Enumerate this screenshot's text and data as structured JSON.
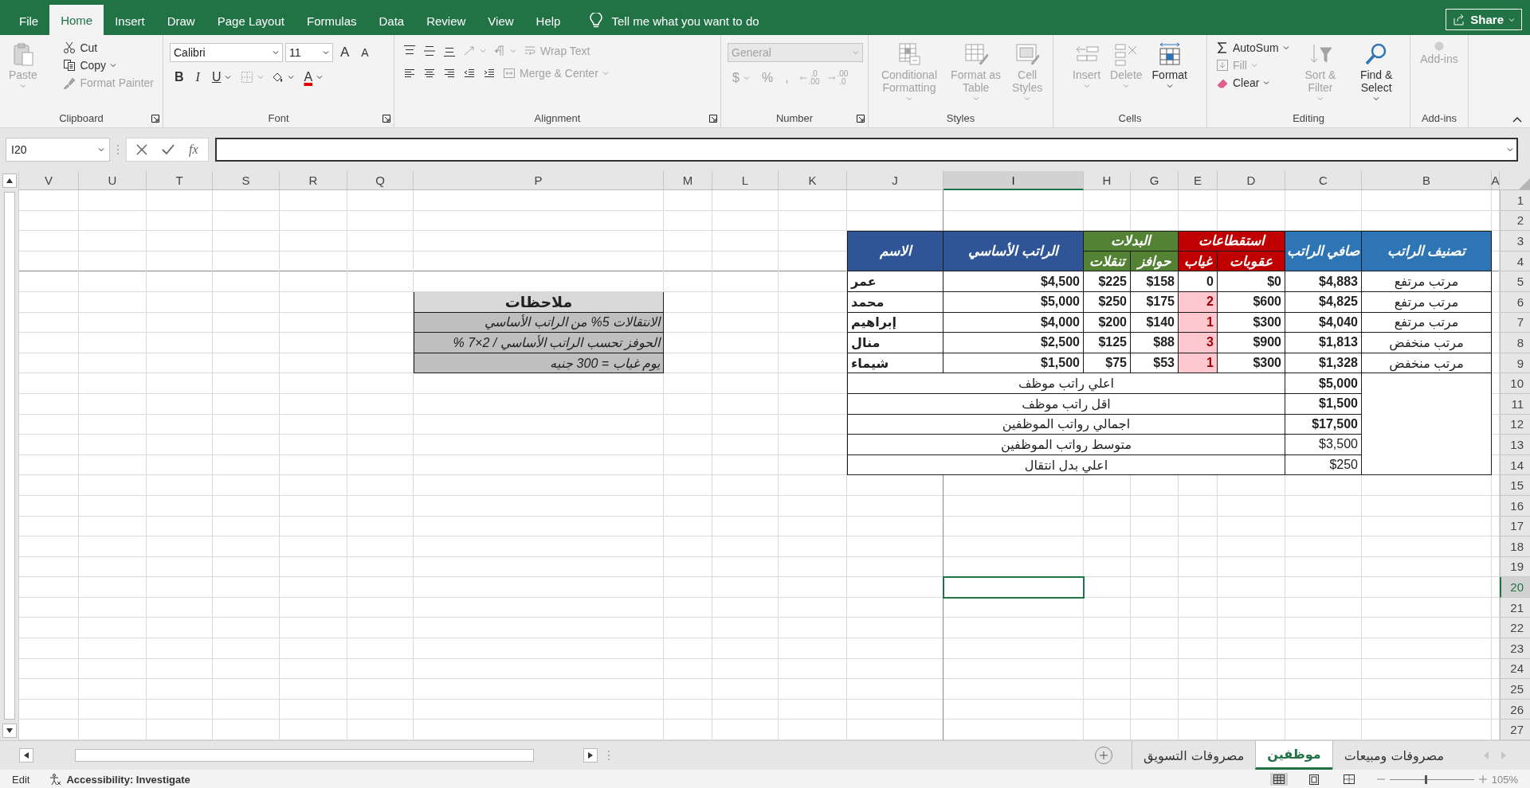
{
  "app_tabs": [
    {
      "label": "File",
      "selected": false
    },
    {
      "label": "Home",
      "selected": true
    },
    {
      "label": "Insert",
      "selected": false
    },
    {
      "label": "Draw",
      "selected": false
    },
    {
      "label": "Page Layout",
      "selected": false
    },
    {
      "label": "Formulas",
      "selected": false
    },
    {
      "label": "Data",
      "selected": false
    },
    {
      "label": "Review",
      "selected": false
    },
    {
      "label": "View",
      "selected": false
    },
    {
      "label": "Help",
      "selected": false
    }
  ],
  "tell_me": "Tell me what you want to do",
  "share": "Share",
  "ribbon": [
    {
      "label": "Clipboard",
      "launcher": true,
      "sections": [
        {
          "kind": "large",
          "items": [
            {
              "kind": "large",
              "label": "Paste",
              "disabled": true,
              "menu": true
            }
          ]
        },
        {
          "kind": "stack",
          "items": [
            {
              "kind": "button",
              "label": "Cut",
              "disabled": false,
              "menu": false
            },
            {
              "kind": "button",
              "label": "Copy",
              "disabled": false,
              "menu": true
            },
            {
              "kind": "button",
              "label": "Format Painter",
              "disabled": true,
              "menu": false
            }
          ]
        }
      ]
    },
    {
      "label": "Font",
      "launcher": true,
      "sections": [
        {
          "kind": "rows",
          "rows": [
            {
              "items": [
                {
                  "kind": "field",
                  "label": "Calibri",
                  "disabled": false,
                  "menu": true
                },
                {
                  "kind": "field",
                  "label": "11",
                  "disabled": false,
                  "menu": true
                },
                {
                  "kind": "glyph",
                  "label": "A",
                  "disabled": false,
                  "menu": false
                },
                {
                  "kind": "glyph",
                  "label": "A",
                  "disabled": false,
                  "menu": false
                }
              ]
            },
            {
              "items": [
                {
                  "kind": "glyph",
                  "label": "B",
                  "disabled": false,
                  "menu": false
                },
                {
                  "kind": "glyph",
                  "label": "I",
                  "disabled": false,
                  "menu": false
                },
                {
                  "kind": "glyph",
                  "label": "U",
                  "disabled": false,
                  "menu": true
                },
                {
                  "kind": "icon",
                  "disabled": true,
                  "menu": true
                },
                {
                  "kind": "icon",
                  "disabled": false,
                  "menu": true
                },
                {
                  "kind": "glyph",
                  "label": "A",
                  "disabled": false,
                  "menu": true
                }
              ]
            }
          ]
        }
      ]
    },
    {
      "label": "Alignment",
      "launcher": true,
      "sections": [
        {
          "kind": "rows",
          "rows": [
            {
              "items": [
                {
                  "kind": "icon",
                  "disabled": false,
                  "menu": false
                },
                {
                  "kind": "icon",
                  "disabled": false,
                  "menu": false
                },
                {
                  "kind": "icon",
                  "disabled": false,
                  "menu": false
                },
                {
                  "kind": "icon",
                  "disabled": true,
                  "menu": true
                },
                {
                  "kind": "icon",
                  "disabled": true,
                  "menu": true
                },
                {
                  "kind": "button",
                  "label": "Wrap Text",
                  "disabled": true,
                  "menu": false
                }
              ]
            },
            {
              "items": [
                {
                  "kind": "icon",
                  "disabled": false,
                  "menu": false
                },
                {
                  "kind": "icon",
                  "disabled": false,
                  "menu": false
                },
                {
                  "kind": "icon",
                  "disabled": false,
                  "menu": false
                },
                {
                  "kind": "icon",
                  "disabled": false,
                  "menu": false
                },
                {
                  "kind": "icon",
                  "disabled": false,
                  "menu": false
                },
                {
                  "kind": "button",
                  "label": "Merge & Center",
                  "disabled": true,
                  "menu": true
                }
              ]
            }
          ]
        }
      ]
    },
    {
      "label": "Number",
      "launcher": true,
      "sections": [
        {
          "kind": "rows",
          "rows": [
            {
              "items": [
                {
                  "kind": "field",
                  "label": "General",
                  "disabled": true,
                  "menu": true
                }
              ]
            },
            {
              "items": [
                {
                  "kind": "glyph",
                  "label": "$",
                  "disabled": true,
                  "menu": true
                },
                {
                  "kind": "glyph",
                  "label": "%",
                  "disabled": true,
                  "menu": false
                },
                {
                  "kind": "glyph",
                  "label": ",",
                  "disabled": true,
                  "menu": false
                },
                {
                  "kind": "decimal",
                  "top": ".0",
                  "bottom": ".00",
                  "disabled": true,
                  "menu": false
                },
                {
                  "kind": "decimal",
                  "top": ".00",
                  "bottom": ".0",
                  "disabled": true,
                  "menu": false
                }
              ]
            }
          ]
        }
      ]
    },
    {
      "label": "Styles",
      "launcher": false,
      "sections": [
        {
          "kind": "large",
          "items": [
            {
              "kind": "large",
              "label": "Conditional Formatting",
              "disabled": true,
              "menu": true
            },
            {
              "kind": "large",
              "label": "Format as Table",
              "disabled": true,
              "menu": true
            },
            {
              "kind": "large",
              "label": "Cell Styles",
              "disabled": true,
              "menu": true
            }
          ]
        }
      ]
    },
    {
      "label": "Cells",
      "launcher": false,
      "sections": [
        {
          "kind": "large",
          "items": [
            {
              "kind": "large",
              "label": "Insert",
              "disabled": true,
              "menu": true
            },
            {
              "kind": "large",
              "label": "Delete",
              "disabled": true,
              "menu": true
            },
            {
              "kind": "large",
              "label": "Format",
              "disabled": false,
              "menu": true
            }
          ]
        }
      ]
    },
    {
      "label": "Editing",
      "launcher": false,
      "sections": [
        {
          "kind": "stack",
          "items": [
            {
              "kind": "button",
              "label": "AutoSum",
              "disabled": false,
              "menu": true
            },
            {
              "kind": "button",
              "label": "Fill",
              "disabled": true,
              "menu": true
            },
            {
              "kind": "button",
              "label": "Clear",
              "disabled": false,
              "menu": true
            }
          ]
        },
        {
          "kind": "large",
          "items": [
            {
              "kind": "large",
              "label": "Sort & Filter",
              "disabled": true,
              "menu": true
            },
            {
              "kind": "large",
              "label": "Find & Select",
              "disabled": false,
              "menu": true
            }
          ]
        }
      ]
    },
    {
      "label": "Add-ins",
      "launcher": false,
      "sections": [
        {
          "kind": "large",
          "items": [
            {
              "kind": "large",
              "label": "Add-ins",
              "disabled": true,
              "menu": false
            }
          ]
        }
      ]
    }
  ],
  "name_box": "I20",
  "fx": "fx",
  "columns": [
    {
      "label": "V",
      "selected": false
    },
    {
      "label": "U",
      "selected": false
    },
    {
      "label": "T",
      "selected": false
    },
    {
      "label": "S",
      "selected": false
    },
    {
      "label": "R",
      "selected": false
    },
    {
      "label": "Q",
      "selected": false
    },
    {
      "label": "P",
      "selected": false
    },
    {
      "label": "M",
      "selected": false
    },
    {
      "label": "L",
      "selected": false
    },
    {
      "label": "K",
      "selected": false
    },
    {
      "label": "J",
      "selected": false
    },
    {
      "label": "I",
      "selected": true
    },
    {
      "label": "H",
      "selected": false
    },
    {
      "label": "G",
      "selected": false
    },
    {
      "label": "E",
      "selected": false
    },
    {
      "label": "D",
      "selected": false
    },
    {
      "label": "C",
      "selected": false
    },
    {
      "label": "B",
      "selected": false
    },
    {
      "label": "A",
      "selected": false
    }
  ],
  "rows": [
    {
      "label": "1",
      "selected": false
    },
    {
      "label": "2",
      "selected": false
    },
    {
      "label": "3",
      "selected": false
    },
    {
      "label": "4",
      "selected": false
    },
    {
      "label": "5",
      "selected": false
    },
    {
      "label": "6",
      "selected": false
    },
    {
      "label": "7",
      "selected": false
    },
    {
      "label": "8",
      "selected": false
    },
    {
      "label": "9",
      "selected": false
    },
    {
      "label": "10",
      "selected": false
    },
    {
      "label": "11",
      "selected": false
    },
    {
      "label": "12",
      "selected": false
    },
    {
      "label": "13",
      "selected": false
    },
    {
      "label": "14",
      "selected": false
    },
    {
      "label": "15",
      "selected": false
    },
    {
      "label": "16",
      "selected": false
    },
    {
      "label": "17",
      "selected": false
    },
    {
      "label": "18",
      "selected": false
    },
    {
      "label": "19",
      "selected": false
    },
    {
      "label": "20",
      "selected": true
    },
    {
      "label": "21",
      "selected": false
    },
    {
      "label": "22",
      "selected": false
    },
    {
      "label": "23",
      "selected": false
    },
    {
      "label": "24",
      "selected": false
    },
    {
      "label": "25",
      "selected": false
    },
    {
      "label": "26",
      "selected": false
    },
    {
      "label": "27",
      "selected": false
    }
  ],
  "salary_table": {
    "headers": {
      "classification": "تصنيف الراتب",
      "net": "صافي الراتب",
      "deductions": "استقطاعات",
      "penalties": "عقوبات",
      "absence": "غياب",
      "allowances": "البدلات",
      "incentives": "حوافز",
      "transport": "تنقلات",
      "base": "الراتب الأساسي",
      "name": "الاسم"
    },
    "rows": [
      {
        "classification": "مرتب مرتفع",
        "net": "$4,883",
        "penalties": "$0",
        "absence": "0",
        "absence_flagged": false,
        "incentives": "$158",
        "transport": "$225",
        "base": "$4,500",
        "name": "عمر"
      },
      {
        "classification": "مرتب مرتفع",
        "net": "$4,825",
        "penalties": "$600",
        "absence": "2",
        "absence_flagged": true,
        "incentives": "$175",
        "transport": "$250",
        "base": "$5,000",
        "name": "محمد"
      },
      {
        "classification": "مرتب مرتفع",
        "net": "$4,040",
        "penalties": "$300",
        "absence": "1",
        "absence_flagged": true,
        "incentives": "$140",
        "transport": "$200",
        "base": "$4,000",
        "name": "إبراهيم"
      },
      {
        "classification": "مرتب منخفض",
        "net": "$1,813",
        "penalties": "$900",
        "absence": "3",
        "absence_flagged": true,
        "incentives": "$88",
        "transport": "$125",
        "base": "$2,500",
        "name": "منال"
      },
      {
        "classification": "مرتب منخفض",
        "net": "$1,328",
        "penalties": "$300",
        "absence": "1",
        "absence_flagged": true,
        "incentives": "$53",
        "transport": "$75",
        "base": "$1,500",
        "name": "شيماء"
      }
    ],
    "summary": [
      {
        "value": "$5,000",
        "bold": true,
        "label": "اعلي راتب موظف"
      },
      {
        "value": "$1,500",
        "bold": true,
        "label": "اقل راتب موظف"
      },
      {
        "value": "$17,500",
        "bold": true,
        "label": "اجمالي رواتب الموظفين"
      },
      {
        "value": "$3,500",
        "bold": false,
        "label": "متوسط رواتب الموظفين"
      },
      {
        "value": "$250",
        "bold": false,
        "label": "اعلي بدل انتقال"
      }
    ]
  },
  "notes": {
    "title": "ملاحظات",
    "items": [
      "الانتقالات 5% من الراتب الأساسي",
      "الحوفز تحسب الراتب الأساسي / 2×7 %",
      "يوم غياب = 300 جنيه"
    ]
  },
  "sheet_tabs": [
    {
      "label": "مصروفات ومبيعات",
      "selected": false
    },
    {
      "label": "موظفين",
      "selected": true
    },
    {
      "label": "مصروفات التسويق",
      "selected": false
    }
  ],
  "status_bar": {
    "mode": "Edit",
    "accessibility": "Accessibility: Investigate",
    "views": [
      {
        "selected": true
      },
      {
        "selected": false
      },
      {
        "selected": false
      }
    ],
    "zoom": {
      "level": 0.42,
      "label": "105%"
    }
  }
}
